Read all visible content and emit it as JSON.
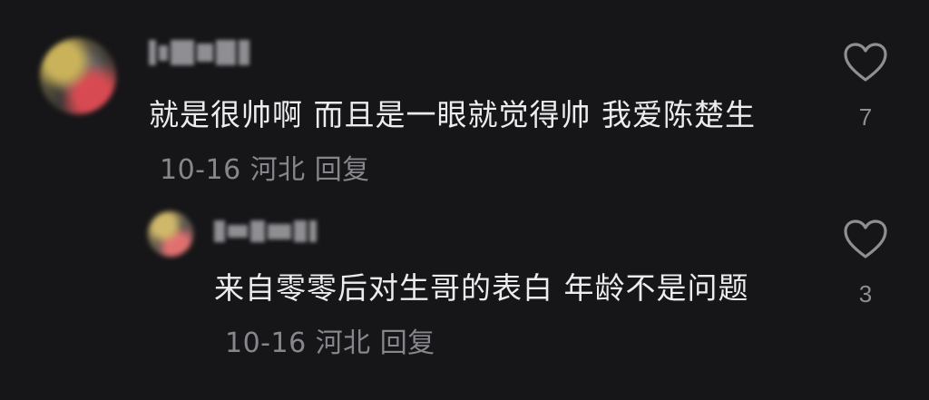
{
  "comments": [
    {
      "text": "就是很帅啊  而且是一眼就觉得帅  我爱陈楚生",
      "date": "10-16",
      "location": "河北",
      "reply_label": "回复",
      "like_count": "7"
    },
    {
      "text": "来自零零后对生哥的表白  年龄不是问题",
      "date": "10-16",
      "location": "河北",
      "reply_label": "回复",
      "like_count": "3"
    }
  ],
  "icons": {
    "like": "heart-outline-icon"
  },
  "colors": {
    "background": "#161618",
    "text": "#ececef",
    "meta": "#86868c"
  }
}
